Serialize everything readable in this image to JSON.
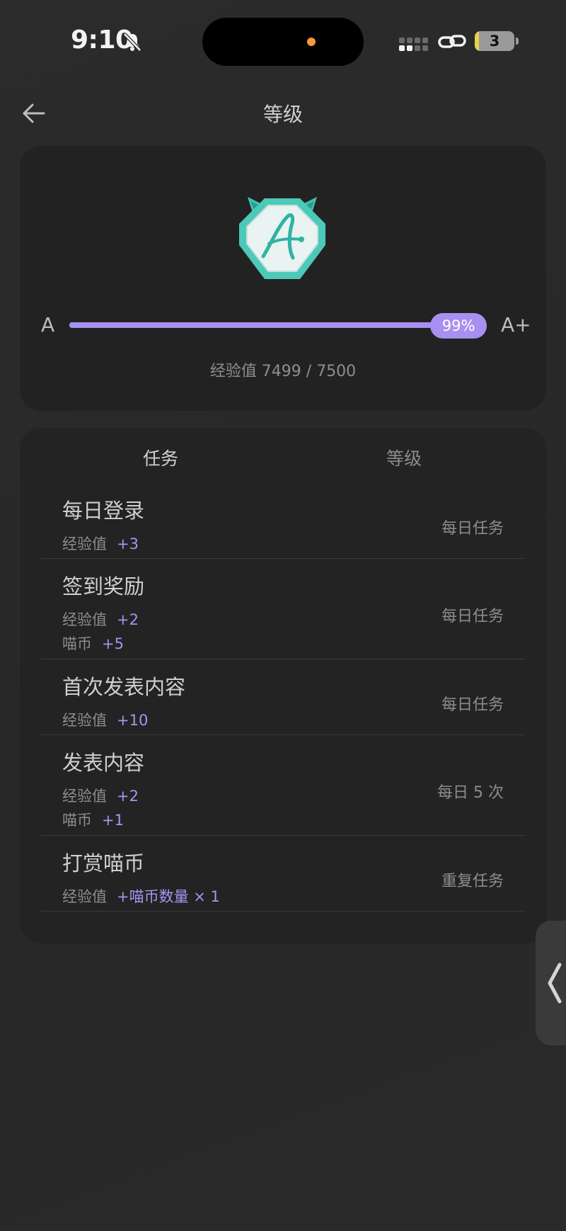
{
  "status_bar": {
    "time": "9:10",
    "battery_level": "3",
    "icons": [
      "bell-off-icon",
      "signal-icon",
      "link-icon",
      "battery-icon"
    ]
  },
  "header": {
    "title": "等级",
    "back_icon": "arrow-left-icon"
  },
  "level_card": {
    "current_level": "A",
    "next_level": "A+",
    "progress_percent_label": "99%",
    "progress": 0.99,
    "exp_text": "经验值 7499 / 7500",
    "badge_icon": "level-a-badge-icon"
  },
  "tabs": [
    {
      "label": "任务",
      "active": true
    },
    {
      "label": "等级",
      "active": false
    }
  ],
  "tasks": [
    {
      "name": "每日登录",
      "type": "每日任务",
      "rewards": [
        {
          "label": "经验值",
          "value": "+3"
        }
      ]
    },
    {
      "name": "签到奖励",
      "type": "每日任务",
      "rewards": [
        {
          "label": "经验值",
          "value": "+2"
        },
        {
          "label": "喵币",
          "value": "+5"
        }
      ]
    },
    {
      "name": "首次发表内容",
      "type": "每日任务",
      "rewards": [
        {
          "label": "经验值",
          "value": "+10"
        }
      ]
    },
    {
      "name": "发表内容",
      "type": "每日 5 次",
      "rewards": [
        {
          "label": "经验值",
          "value": "+2"
        },
        {
          "label": "喵币",
          "value": "+1"
        }
      ]
    },
    {
      "name": "打赏喵币",
      "type": "重复任务",
      "rewards": [
        {
          "label": "经验值",
          "value": "+喵币数量 × 1"
        }
      ]
    }
  ],
  "colors": {
    "accent": "#a790f0",
    "background": "#2b2b2b",
    "card": "#222222",
    "badge_teal": "#4cc9b8"
  }
}
